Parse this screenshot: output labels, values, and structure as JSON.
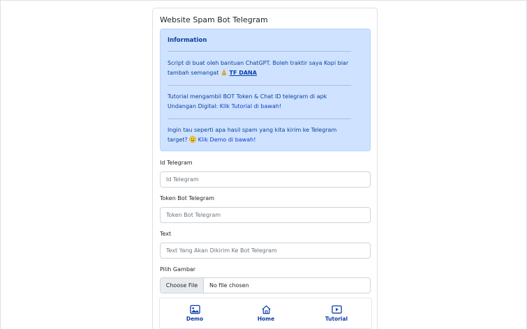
{
  "card": {
    "title": "Website Spam Bot Telegram"
  },
  "info": {
    "heading": "Information",
    "p1_text": "Script di buat oleh bantuan ChatGPT. Boleh traktir saya Kopi biar tambah semangat",
    "p1_link": "TF DANA",
    "p2_text": "Tutorial mengambil BOT Token & Chat ID telegram di apk Undangan Digital:",
    "p2_link": "Klik Tutorial di bawah!",
    "p3_text": "Ingin tau seperti apa hasil spam yang kita kirim ke Telegram target?",
    "p3_link": "Klik Demo di bawah!"
  },
  "form": {
    "id_label": "Id Telegram",
    "id_placeholder": "Id Telegram",
    "token_label": "Token Bot Telegram",
    "token_placeholder": "Token Bot Telegram",
    "text_label": "Text",
    "text_placeholder": "Text Yang Akan Dikirim Ke Bot Telegram",
    "image_label": "Pilih Gambar",
    "file_button": "Choose File",
    "file_status": "No file chosen"
  },
  "nav": {
    "items": [
      {
        "label": "Demo",
        "icon": "image-icon"
      },
      {
        "label": "Home",
        "icon": "home-icon"
      },
      {
        "label": "Tutorial",
        "icon": "play-icon"
      }
    ]
  },
  "colors": {
    "alert_bg": "#cfe2ff",
    "alert_text": "#084298",
    "nav_accent": "#0d3ea8"
  }
}
